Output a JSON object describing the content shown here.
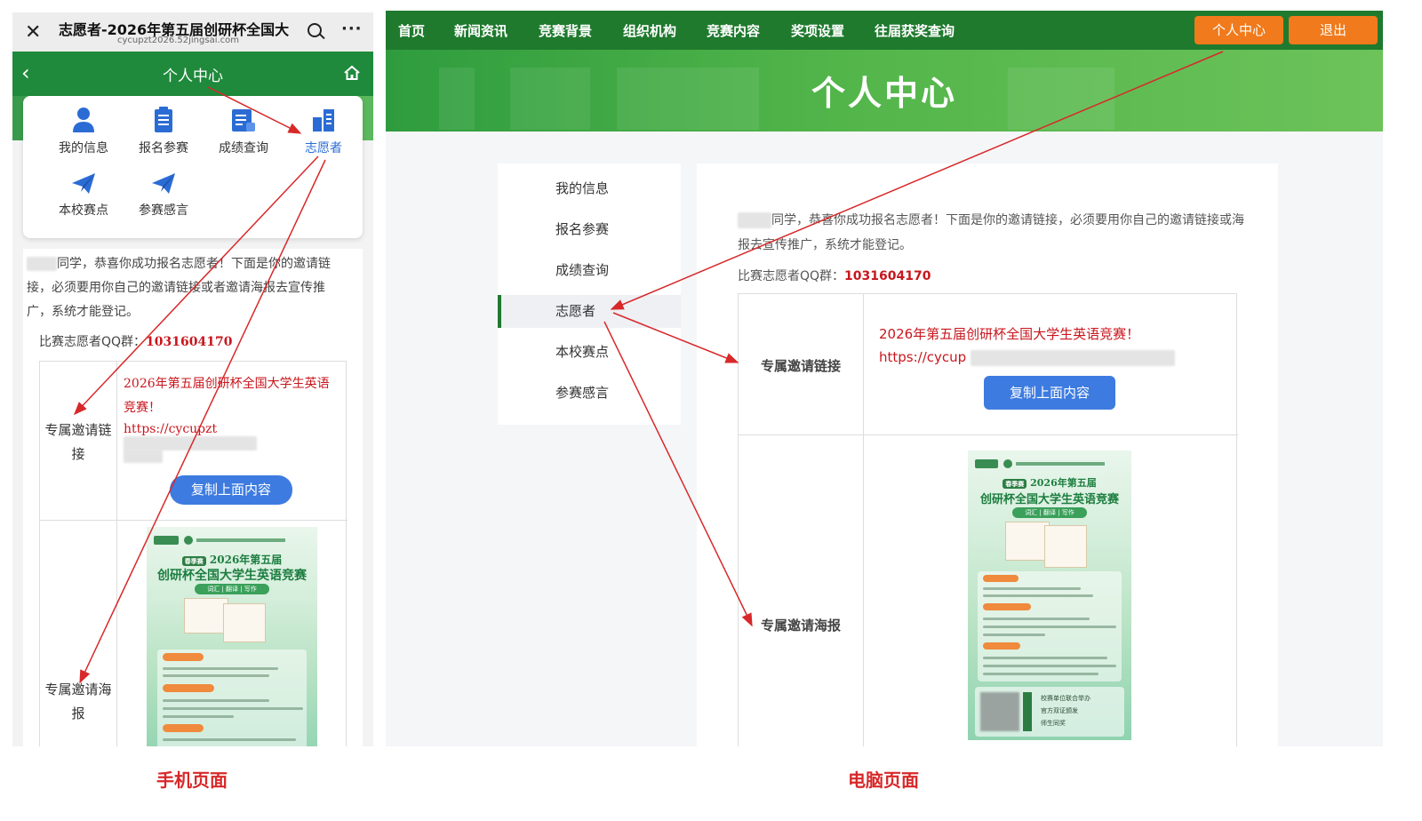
{
  "mobile": {
    "window_title": "志愿者-2026年第五届创研杯全国大",
    "url": "cycupzt2026.52jingsai.com",
    "header_title": "个人中心",
    "menu": [
      {
        "label": "我的信息",
        "icon": "user-icon"
      },
      {
        "label": "报名参赛",
        "icon": "signup-list-icon"
      },
      {
        "label": "成绩查询",
        "icon": "score-report-icon"
      },
      {
        "label": "志愿者",
        "icon": "volunteer-icon"
      },
      {
        "label": "本校赛点",
        "icon": "paper-plane-icon"
      },
      {
        "label": "参赛感言",
        "icon": "paper-plane-icon"
      }
    ],
    "message": "同学，恭喜你成功报名志愿者！下面是你的邀请链接，必须要用你自己的邀请链接或者邀请海报去宣传推广，系统才能登记。",
    "qq_label": "比赛志愿者QQ群：",
    "qq_value": "1031604170",
    "link_label": "专属邀请链接",
    "invite_text": "2026年第五届创研杯全国大学生英语竞赛！",
    "invite_url": "https://cycupzt",
    "copy_button": "复制上面内容",
    "poster_label": "专属邀请海报"
  },
  "desktop": {
    "nav": [
      "首页",
      "新闻资讯",
      "竞赛背景",
      "组织机构",
      "竞赛内容",
      "奖项设置",
      "往届获奖查询"
    ],
    "personal_center_button": "个人中心",
    "logout_button": "退出",
    "banner_title": "个人中心",
    "sidebar": [
      "我的信息",
      "报名参赛",
      "成绩查询",
      "志愿者",
      "本校赛点",
      "参赛感言"
    ],
    "active_sidebar": "志愿者",
    "message": "同学，恭喜你成功报名志愿者！下面是你的邀请链接，必须要用你自己的邀请链接或海报去宣传推广，系统才能登记。",
    "qq_label": "比赛志愿者QQ群：",
    "qq_value": "1031604170",
    "link_label": "专属邀请链接",
    "invite_text": "2026年第五届创研杯全国大学生英语竞赛！",
    "invite_url": "https://cycup",
    "copy_button": "复制上面内容",
    "poster_label": "专属邀请海报"
  },
  "poster": {
    "season_tag": "春季赛",
    "edition": "2026年第五届",
    "title": "创研杯全国大学生英语竞赛",
    "subtitle": "词汇 | 翻译 | 写作",
    "sections": [
      "组织单位",
      "报名截止时间",
      "奖项设置"
    ],
    "footer_lines": [
      "校赛单位联合举办",
      "官方双证颁发",
      "师生同奖"
    ]
  },
  "captions": {
    "mobile": "手机页面",
    "desktop": "电脑页面"
  },
  "colors": {
    "brand_green": "#1f7a2e",
    "accent_orange": "#f07a1c",
    "button_blue": "#3d7be0",
    "highlight_red": "#c8161d",
    "annotation_red": "#d8282a"
  }
}
